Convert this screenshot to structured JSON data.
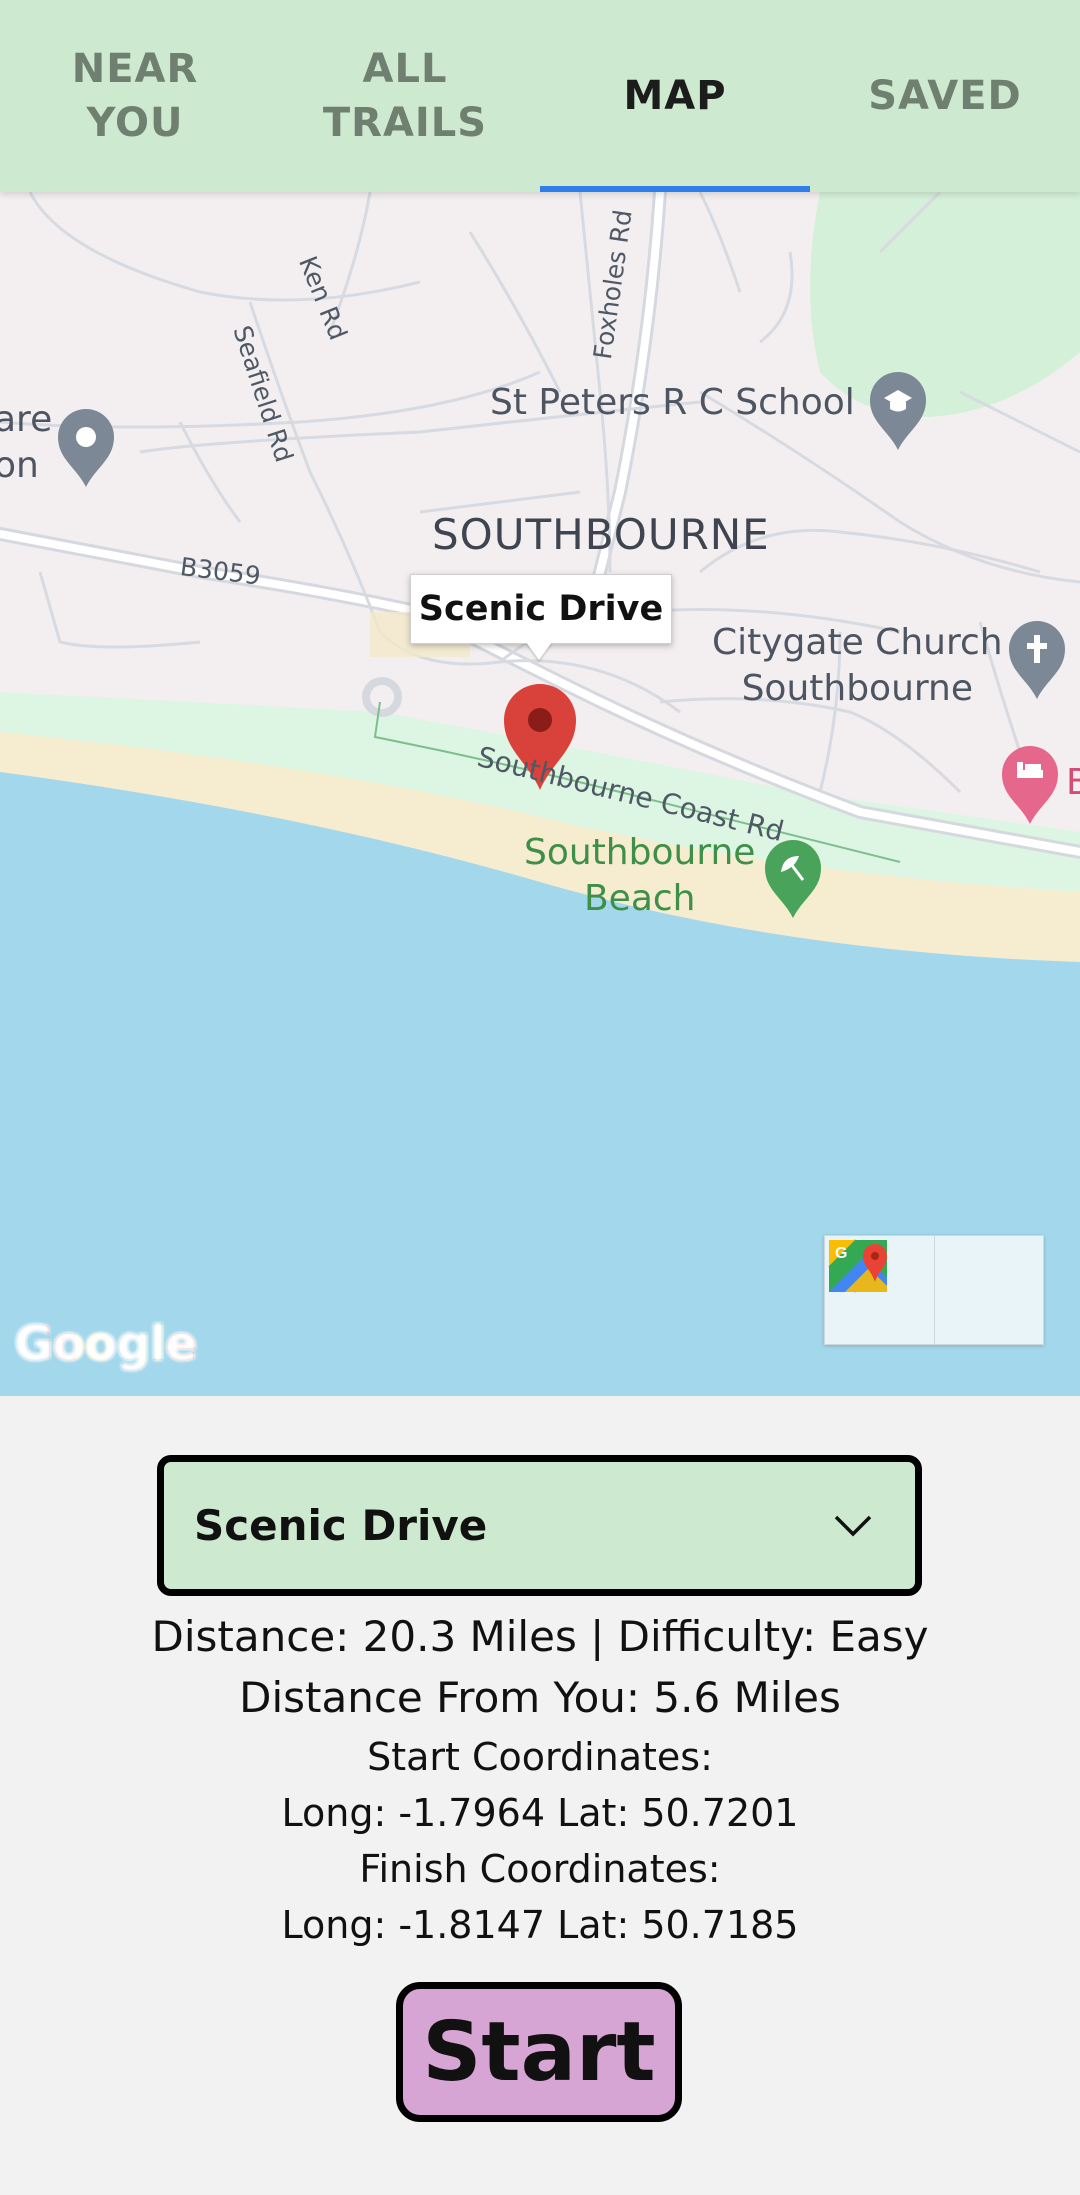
{
  "tabs": [
    {
      "label": "NEAR\nYOU",
      "active": false
    },
    {
      "label": "ALL\nTRAILS",
      "active": false
    },
    {
      "label": "MAP",
      "active": true
    },
    {
      "label": "SAVED",
      "active": false
    }
  ],
  "map": {
    "roads": {
      "ken": "Ken Rd",
      "seafield": "Seafield Rd",
      "foxholes": "Foxholes Rd",
      "b3059": "B3059",
      "southbourne_coast": "Southbourne Coast Rd"
    },
    "places": {
      "district": "SOUTHBOURNE",
      "school": "St Peters R C School",
      "church": "Citygate Church\nSouthbourne",
      "beach": "Southbourne\nBeach",
      "partial_left": "are\non",
      "partial_right": "B"
    },
    "callout": "Scenic Drive",
    "logo": "Google",
    "icons": {
      "marker": "map-marker-red",
      "school": "graduation-cap-pin",
      "church": "cross-pin",
      "hotel": "bed-pin",
      "beach": "beach-umbrella-pin",
      "generic": "location-pin",
      "directions": "directions-arrow",
      "open_maps": "google-maps-app"
    },
    "colors": {
      "land": "#f3eff0",
      "water": "#a3d8ec",
      "sand": "#f6ecd0",
      "park": "#d4f0d8",
      "marker": "#d9423a"
    }
  },
  "route": {
    "selected": "Scenic Drive",
    "summary": "Distance: 20.3 Miles | Difficulty: Easy",
    "distance_from_you": "Distance From You: 5.6 Miles",
    "start_heading": "Start Coordinates:",
    "start_coords": "Long: -1.7964 Lat: 50.7201",
    "finish_heading": "Finish Coordinates:",
    "finish_coords": "Long: -1.8147 Lat: 50.7185"
  },
  "actions": {
    "start": "Start"
  },
  "colors": {
    "tab_bar": "#cde9cf",
    "tab_indicator": "#2f7de6",
    "select_bg": "#cde9cf",
    "start_bg": "#d7a5d4"
  }
}
